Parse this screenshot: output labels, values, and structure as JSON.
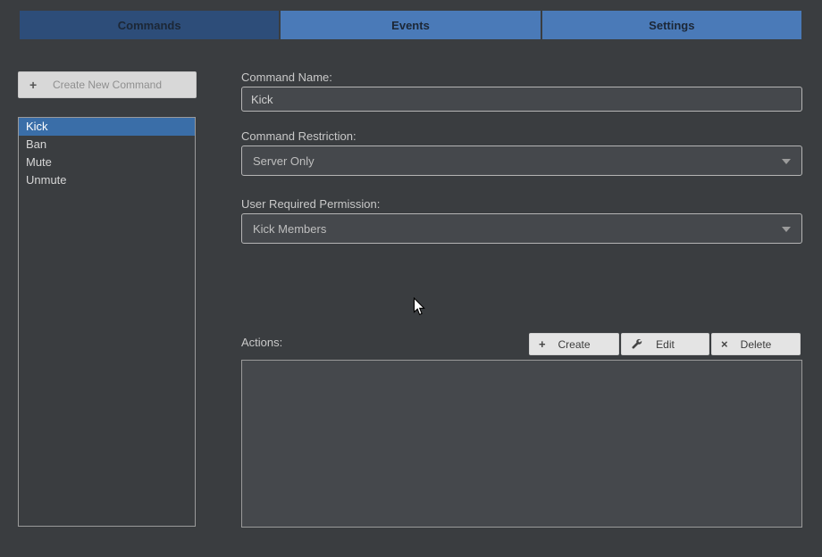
{
  "tabs": [
    {
      "label": "Commands",
      "active": true
    },
    {
      "label": "Events",
      "active": false
    },
    {
      "label": "Settings",
      "active": false
    }
  ],
  "sidebar": {
    "create_button_label": "Create New Command",
    "commands": [
      "Kick",
      "Ban",
      "Mute",
      "Unmute"
    ],
    "selected_command": "Kick"
  },
  "form": {
    "command_name_label": "Command Name:",
    "command_name_value": "Kick",
    "restriction_label": "Command Restriction:",
    "restriction_value": "Server Only",
    "permission_label": "User Required Permission:",
    "permission_value": "Kick Members",
    "actions_label": "Actions:",
    "action_buttons": {
      "create": "Create",
      "edit": "Edit",
      "delete": "Delete"
    }
  },
  "colors": {
    "background": "#3a3d40",
    "tab_active": "#2d4d79",
    "tab_inactive": "#4a7ab8",
    "selection_blue": "#3a6ea8",
    "field_background": "#45484c",
    "light_button": "#e4e4e4"
  }
}
